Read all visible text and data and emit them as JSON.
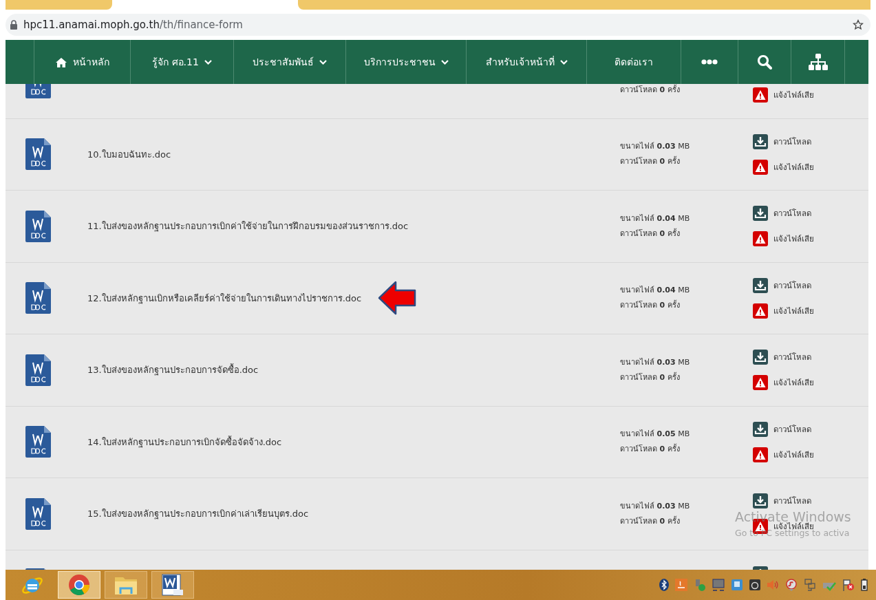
{
  "browser": {
    "url_host": "hpc11.anamai.moph.go.th",
    "url_path": "/th/finance-form"
  },
  "nav": [
    {
      "kind": "home",
      "label": "หน้าหลัก"
    },
    {
      "kind": "dropdown",
      "label": "รู้จัก ศอ.11"
    },
    {
      "kind": "dropdown",
      "label": "ประชาสัมพันธ์"
    },
    {
      "kind": "dropdown",
      "label": "บริการประชาชน"
    },
    {
      "kind": "dropdown",
      "label": "สำหรับเจ้าหน้าที่"
    },
    {
      "kind": "link",
      "label": "ติดต่อเรา"
    },
    {
      "kind": "more"
    },
    {
      "kind": "search"
    },
    {
      "kind": "sitemap"
    }
  ],
  "files": [
    {
      "downloads": "ดาวน์โหลด **0** ครั้ง",
      "report_label": "แจ้งไฟล์เสีย",
      "marked": false
    },
    {
      "name": "10.ใบมอบฉันทะ.doc",
      "size": "ขนาดไฟล์ **0.03** MB",
      "downloads": "ดาวน์โหลด **0** ครั้ง",
      "download_label": "ดาวน์โหลด",
      "report_label": "แจ้งไฟล์เสีย",
      "marked": false
    },
    {
      "name": "11.ใบส่งของหลักฐานประกอบการเบิกค่าใช้จ่ายในการฝึกอบรมของส่วนราชการ.doc",
      "size": "ขนาดไฟล์ **0.04** MB",
      "downloads": "ดาวน์โหลด **0** ครั้ง",
      "download_label": "ดาวน์โหลด",
      "report_label": "แจ้งไฟล์เสีย",
      "marked": false
    },
    {
      "name": "12.ใบส่งหลักฐานเบิกหรือเคลียร์ค่าใช้จ่ายในการเดินทางไปราชการ.doc",
      "size": "ขนาดไฟล์ **0.04** MB",
      "downloads": "ดาวน์โหลด **0** ครั้ง",
      "download_label": "ดาวน์โหลด",
      "report_label": "แจ้งไฟล์เสีย",
      "marked": true
    },
    {
      "name": "13.ใบส่งของหลักฐานประกอบการจัดซื้อ.doc",
      "size": "ขนาดไฟล์ **0.03** MB",
      "downloads": "ดาวน์โหลด **0** ครั้ง",
      "download_label": "ดาวน์โหลด",
      "report_label": "แจ้งไฟล์เสีย",
      "marked": false
    },
    {
      "name": "14.ใบส่งหลักฐานประกอบการเบิกจัดซื้อจัดจ้าง.doc",
      "size": "ขนาดไฟล์ **0.05** MB",
      "downloads": "ดาวน์โหลด **0** ครั้ง",
      "download_label": "ดาวน์โหลด",
      "report_label": "แจ้งไฟล์เสีย",
      "marked": false
    },
    {
      "name": "15.ใบส่งของหลักฐานประกอบการเบิกค่าเล่าเรียนบุตร.doc",
      "size": "ขนาดไฟล์ **0.03** MB",
      "downloads": "ดาวน์โหลด **0** ครั้ง",
      "download_label": "ดาวน์โหลด",
      "report_label": "แจ้งไฟล์เสีย",
      "marked": false
    },
    {
      "marked": false
    }
  ],
  "os_notice": {
    "title": "Activate Windows",
    "text": "Go to PC settings to activa"
  },
  "taskbar": {
    "apps": [
      {
        "kind": "ie",
        "selected": false
      },
      {
        "kind": "chrome",
        "selected": true
      },
      {
        "kind": "explorer",
        "selected": false
      },
      {
        "kind": "word",
        "selected": false
      }
    ],
    "tray": [
      {
        "kind": "bluetooth"
      },
      {
        "kind": "java"
      },
      {
        "kind": "usb"
      },
      {
        "kind": "monitor"
      },
      {
        "kind": "app"
      },
      {
        "kind": "camera"
      },
      {
        "kind": "speaker"
      },
      {
        "kind": "shield"
      },
      {
        "kind": "network"
      },
      {
        "kind": "printer"
      },
      {
        "kind": "flag"
      },
      {
        "kind": "battery"
      }
    ]
  }
}
